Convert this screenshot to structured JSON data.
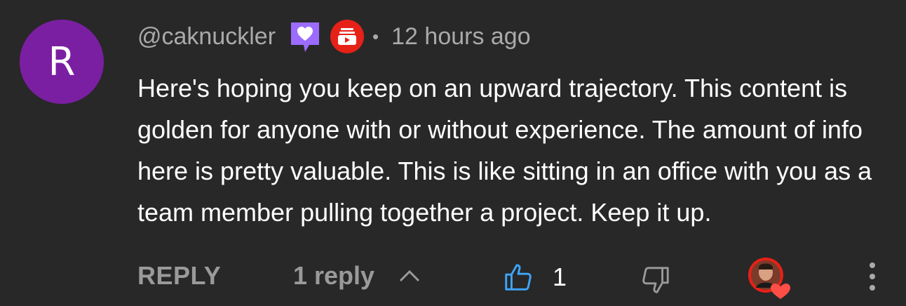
{
  "comment": {
    "avatar_letter": "R",
    "avatar_color": "#7b1fa2",
    "username": "@caknuckler",
    "separator": "•",
    "timestamp": "12 hours ago",
    "badges": [
      "member-heart-badge-icon",
      "youtube-stack-badge-icon"
    ],
    "text": "Here's hoping you keep on an upward trajectory. This content is golden for anyone with or without experience. The amount of info here is pretty valuable. This is like sitting in an office with you as a team member pulling together a project. Keep it up."
  },
  "actions": {
    "reply_label": "REPLY",
    "replies_label": "1 reply",
    "like_count": "1",
    "like_color": "#3ea6ff",
    "heart_color": "#ff4e45"
  }
}
